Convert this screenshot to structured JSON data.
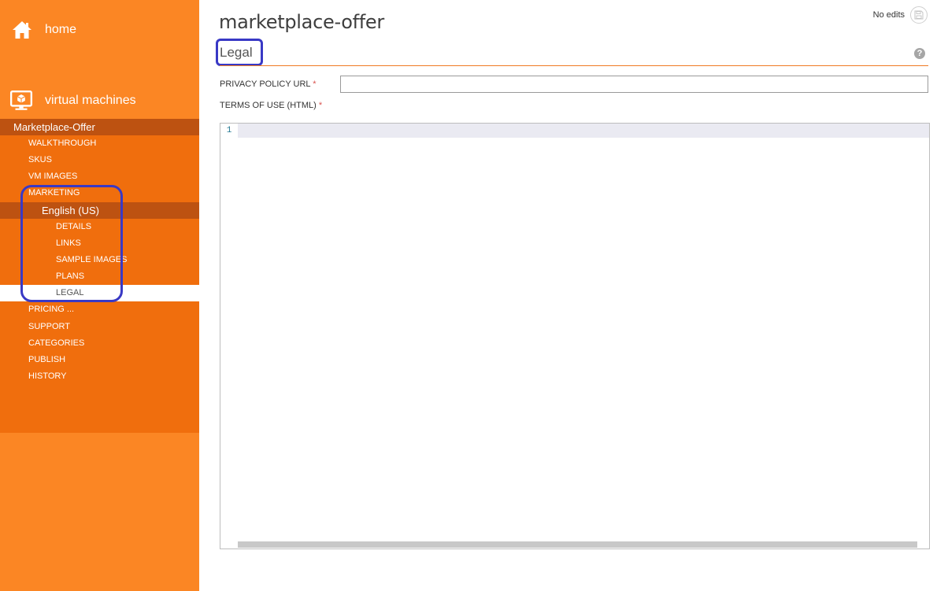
{
  "sidebar": {
    "home_label": "home",
    "vm_label": "virtual machines",
    "offer_label": "Marketplace-Offer",
    "items": [
      {
        "label": "WALKTHROUGH"
      },
      {
        "label": "SKUS"
      },
      {
        "label": "VM IMAGES"
      },
      {
        "label": "MARKETING"
      }
    ],
    "language_label": "English (US)",
    "sub_items": [
      {
        "label": "DETAILS"
      },
      {
        "label": "LINKS"
      },
      {
        "label": "SAMPLE IMAGES"
      },
      {
        "label": "PLANS"
      },
      {
        "label": "LEGAL"
      }
    ],
    "bottom_items": [
      {
        "label": "PRICING ..."
      },
      {
        "label": "SUPPORT"
      },
      {
        "label": "CATEGORIES"
      },
      {
        "label": "PUBLISH"
      },
      {
        "label": "HISTORY"
      }
    ]
  },
  "main": {
    "title": "marketplace-offer",
    "status": "No edits",
    "section_title": "Legal",
    "privacy_label": "PRIVACY POLICY URL",
    "privacy_value": "",
    "terms_label": "TERMS OF USE (HTML)",
    "required_marker": "*",
    "editor_line_number": "1",
    "help_glyph": "?"
  },
  "colors": {
    "sidebar_bg": "#fb8624",
    "sidebar_dark": "#f06e0d",
    "header_band": "#bd5211",
    "accent_rule": "#f07a22",
    "annotation": "#3939c5"
  }
}
